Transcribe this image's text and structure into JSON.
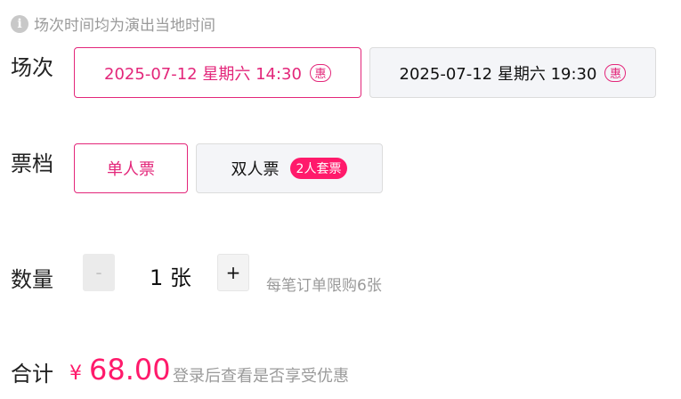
{
  "notice": {
    "icon": "info-icon",
    "text": "场次时间均为演出当地时间"
  },
  "session": {
    "label": "场次",
    "options": [
      {
        "text": "2025-07-12 星期六 14:30",
        "tag": "惠",
        "selected": true
      },
      {
        "text": "2025-07-12 星期六 19:30",
        "tag": "惠",
        "selected": false
      }
    ]
  },
  "ticket": {
    "label": "票档",
    "options": [
      {
        "text": "单人票",
        "selected": true
      },
      {
        "text": "双人票",
        "badge": "2人套票",
        "selected": false
      }
    ]
  },
  "quantity": {
    "label": "数量",
    "minus": "-",
    "value": "1 张",
    "plus": "+",
    "limit": "每笔订单限购6张"
  },
  "total": {
    "label": "合计",
    "currency": "¥",
    "amount": "68.00",
    "login_hint": "登录后查看是否享受优惠"
  },
  "colors": {
    "accent": "#e3267a",
    "badge": "#ff1a6b",
    "muted": "#9a9a9a"
  }
}
